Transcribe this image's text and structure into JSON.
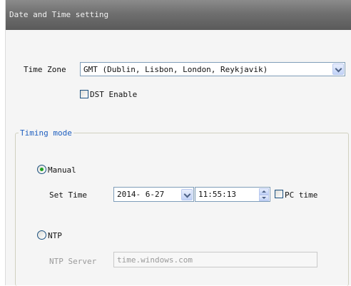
{
  "header": {
    "title": "Date and Time setting"
  },
  "time_zone": {
    "label": "Time Zone",
    "selected": "GMT (Dublin, Lisbon, London, Reykjavik)"
  },
  "dst": {
    "label": "DST Enable",
    "checked": false
  },
  "timing_mode": {
    "legend": "Timing mode",
    "manual": {
      "label": "Manual",
      "selected": true
    },
    "set_time": {
      "label": "Set Time",
      "date": "2014- 6-27",
      "time": "11:55:13",
      "pc_time_label": "PC time",
      "pc_time_checked": false
    },
    "ntp": {
      "label": "NTP",
      "selected": false
    },
    "ntp_server": {
      "label": "NTP Server",
      "value": "time.windows.com"
    }
  },
  "colors": {
    "header_bg": "#6f6f6f",
    "legend_text": "#1f5fbf",
    "radio_selected": "#21a121",
    "disabled_text": "#9a9a9a"
  }
}
